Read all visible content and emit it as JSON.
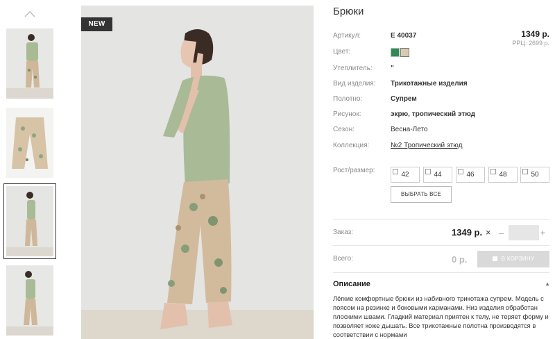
{
  "badge": "NEW",
  "product": {
    "title": "Брюки",
    "price": "1349 р.",
    "rrc": "РРЦ: 2699 р."
  },
  "attributes": {
    "article": {
      "label": "Артикул:",
      "value": "Е 40037"
    },
    "color": {
      "label": "Цвет:",
      "swatches": [
        "#2e8b57",
        "#d9cbb0"
      ]
    },
    "insulation": {
      "label": "Утеплитель:",
      "value": "\""
    },
    "product_type": {
      "label": "Вид изделия:",
      "value": "Трикотажные изделия"
    },
    "fabric": {
      "label": "Полотно:",
      "value": "Супрем"
    },
    "pattern": {
      "label": "Рисунок:",
      "value": "экрю, тропический этюд"
    },
    "season": {
      "label": "Сезон:",
      "value": "Весна-Лето"
    },
    "collection": {
      "label": "Коллекция:",
      "value": "№2 Тропический этюд"
    }
  },
  "sizes": {
    "label": "Рост/размер:",
    "options": [
      "42",
      "44",
      "46",
      "48",
      "50"
    ],
    "select_all": "ВЫБРАТЬ ВСЕ"
  },
  "order": {
    "label": "Заказ:",
    "price": "1349 р.",
    "times": "×",
    "minus": "–",
    "plus": "+",
    "quantity": ""
  },
  "total": {
    "label": "Всего:",
    "value": "0 р.",
    "cart_button": "В КОРЗИНУ"
  },
  "description": {
    "title": "Описание",
    "text": "Лёгкие комфортные брюки из набивного трикотажа супрем. Модель с поясом на резинке и боковыми карманами. Низ изделия обработан плоскими швами. Гладкий материал приятен к телу, не теряет форму и позволяет коже дышать. Все трикотажные полотна производятся в соответствии с нормами"
  }
}
